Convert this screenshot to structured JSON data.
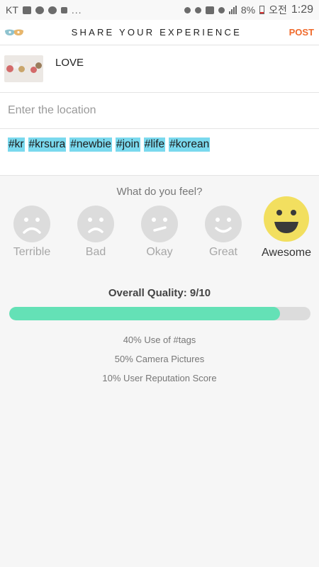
{
  "status_bar": {
    "carrier": "KT",
    "battery": "8%",
    "clock_prefix": "오전",
    "time": "1:29",
    "overflow": "..."
  },
  "header": {
    "title": "SHARE YOUR EXPERIENCE",
    "post_label": "POST",
    "accent": "#f06a2b"
  },
  "post": {
    "title": "LOVE",
    "location_placeholder": "Enter the location",
    "tags": [
      "#kr",
      "#krsura",
      "#newbie",
      "#join",
      "#life",
      "#korean"
    ]
  },
  "feelings": {
    "question": "What do you feel?",
    "options": [
      {
        "label": "Terrible",
        "mood": "terrible",
        "selected": false
      },
      {
        "label": "Bad",
        "mood": "bad",
        "selected": false
      },
      {
        "label": "Okay",
        "mood": "okay",
        "selected": false
      },
      {
        "label": "Great",
        "mood": "great",
        "selected": false
      },
      {
        "label": "Awesome",
        "mood": "awesome",
        "selected": true
      }
    ]
  },
  "quality": {
    "label": "Overall Quality: 9/10",
    "progress": 0.9,
    "bar_color": "#64e1b6",
    "metrics": [
      "40% Use of #tags",
      "50% Camera Pictures",
      "10% User Reputation Score"
    ]
  }
}
